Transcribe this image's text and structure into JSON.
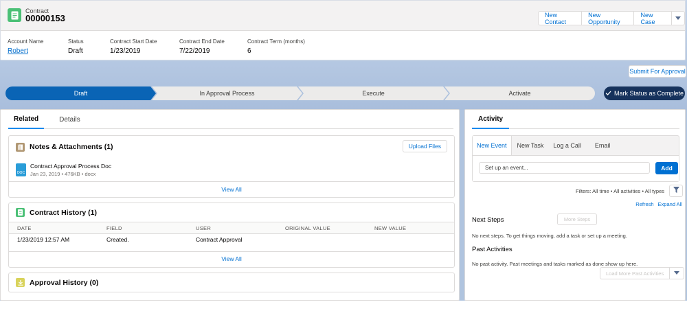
{
  "record": {
    "object_label": "Contract",
    "title": "00000153",
    "actions": [
      "New Contact",
      "New Opportunity",
      "New Case"
    ]
  },
  "fields": [
    {
      "label": "Account Name",
      "value": "Robert",
      "link": true
    },
    {
      "label": "Status",
      "value": "Draft",
      "link": false
    },
    {
      "label": "Contract Start Date",
      "value": "1/23/2019",
      "link": false
    },
    {
      "label": "Contract End Date",
      "value": "7/22/2019",
      "link": false
    },
    {
      "label": "Contract Term (months)",
      "value": "6",
      "link": false
    }
  ],
  "submit_label": "Submit For Approval",
  "path": {
    "stages": [
      "Draft",
      "In Approval Process",
      "Execute",
      "Activate"
    ],
    "active": "Draft",
    "mark_label": "Mark Status as Complete"
  },
  "tabs": {
    "related": "Related",
    "details": "Details"
  },
  "notes": {
    "title": "Notes & Attachments (1)",
    "upload_label": "Upload Files",
    "file_name": "Contract Approval Process Doc",
    "file_meta": "Jan 23, 2019 • 476KB • docx",
    "file_type": "DOC",
    "view_all": "View All"
  },
  "history": {
    "title": "Contract History (1)",
    "columns": [
      "DATE",
      "FIELD",
      "USER",
      "ORIGINAL VALUE",
      "NEW VALUE"
    ],
    "rows": [
      [
        "1/23/2019 12:57 AM",
        "Created.",
        "Contract Approval",
        "",
        ""
      ]
    ],
    "view_all": "View All"
  },
  "approval": {
    "title": "Approval History (0)"
  },
  "activity": {
    "tab": "Activity",
    "composer_tabs": [
      "New Event",
      "New Task",
      "Log a Call",
      "Email"
    ],
    "event_placeholder": "Set up an event...",
    "add_label": "Add",
    "filters": "Filters: All time • All activities • All types",
    "refresh": "Refresh",
    "expand": "Expand All",
    "next_steps_title": "Next Steps",
    "more_steps": "More Steps",
    "next_steps_text": "No next steps. To get things moving, add a task or set up a meeting.",
    "past_title": "Past Activities",
    "past_text": "No past activity. Past meetings and tasks marked as done show up here.",
    "load_more": "Load More Past Activities"
  },
  "colors": {
    "brand": "#0070d2",
    "contract_icon": "#4bc076",
    "path_active": "#0a64b5",
    "mark_button": "#16325c"
  }
}
